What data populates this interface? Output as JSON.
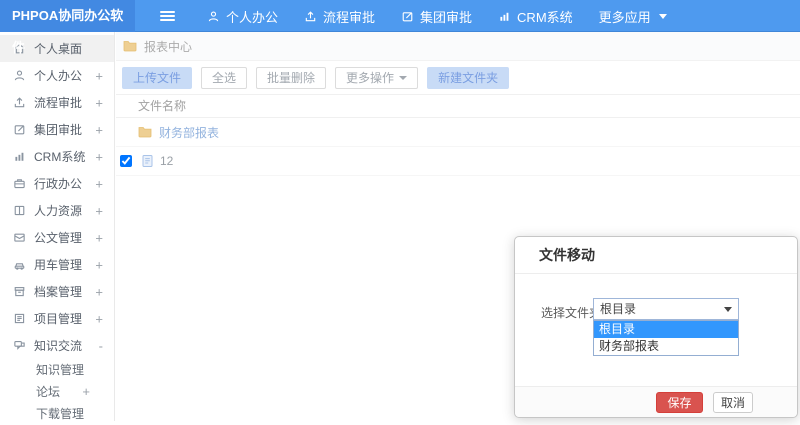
{
  "brand": "PHPOA协同办公软件",
  "header": {
    "nav": [
      {
        "label": "个人办公"
      },
      {
        "label": "流程审批"
      },
      {
        "label": "集团审批"
      },
      {
        "label": "CRM系统"
      },
      {
        "label": "更多应用"
      }
    ]
  },
  "sidebar": {
    "items": [
      {
        "label": "个人桌面",
        "expander": ""
      },
      {
        "label": "个人办公",
        "expander": "+"
      },
      {
        "label": "流程审批",
        "expander": "+"
      },
      {
        "label": "集团审批",
        "expander": "+"
      },
      {
        "label": "CRM系统",
        "expander": "+"
      },
      {
        "label": "行政办公",
        "expander": "+"
      },
      {
        "label": "人力资源",
        "expander": "+"
      },
      {
        "label": "公文管理",
        "expander": "+"
      },
      {
        "label": "用车管理",
        "expander": "+"
      },
      {
        "label": "档案管理",
        "expander": "+"
      },
      {
        "label": "项目管理",
        "expander": "+"
      },
      {
        "label": "知识交流",
        "expander": "-"
      }
    ],
    "submenu": [
      {
        "label": "知识管理",
        "expander": ""
      },
      {
        "label": "论坛",
        "expander": "+"
      },
      {
        "label": "下载管理",
        "expander": ""
      }
    ]
  },
  "breadcrumb": {
    "label": "报表中心"
  },
  "toolbar": {
    "upload": "上传文件",
    "select_all": "全选",
    "batch_delete": "批量删除",
    "more_ops": "更多操作",
    "new_folder": "新建文件夹"
  },
  "files": {
    "header": "文件名称",
    "folder_name": "财务部报表",
    "file_name": "12",
    "file_checked": "checked"
  },
  "dialog": {
    "title": "文件移动",
    "label": "选择文件夹",
    "selected": "根目录",
    "options": [
      "根目录",
      "财务部报表"
    ],
    "save": "保存",
    "cancel": "取消"
  },
  "colors": {
    "header_bg": "#4e9aef",
    "brand_bg": "#4289e2",
    "soft_button_bg": "#c8dbf6",
    "soft_button_text": "#7b9fe2",
    "option_selected_bg": "#3297fd",
    "save_button_bg": "#d9534f",
    "folder_icon": "#eecf93",
    "link_text": "#93b3de"
  }
}
